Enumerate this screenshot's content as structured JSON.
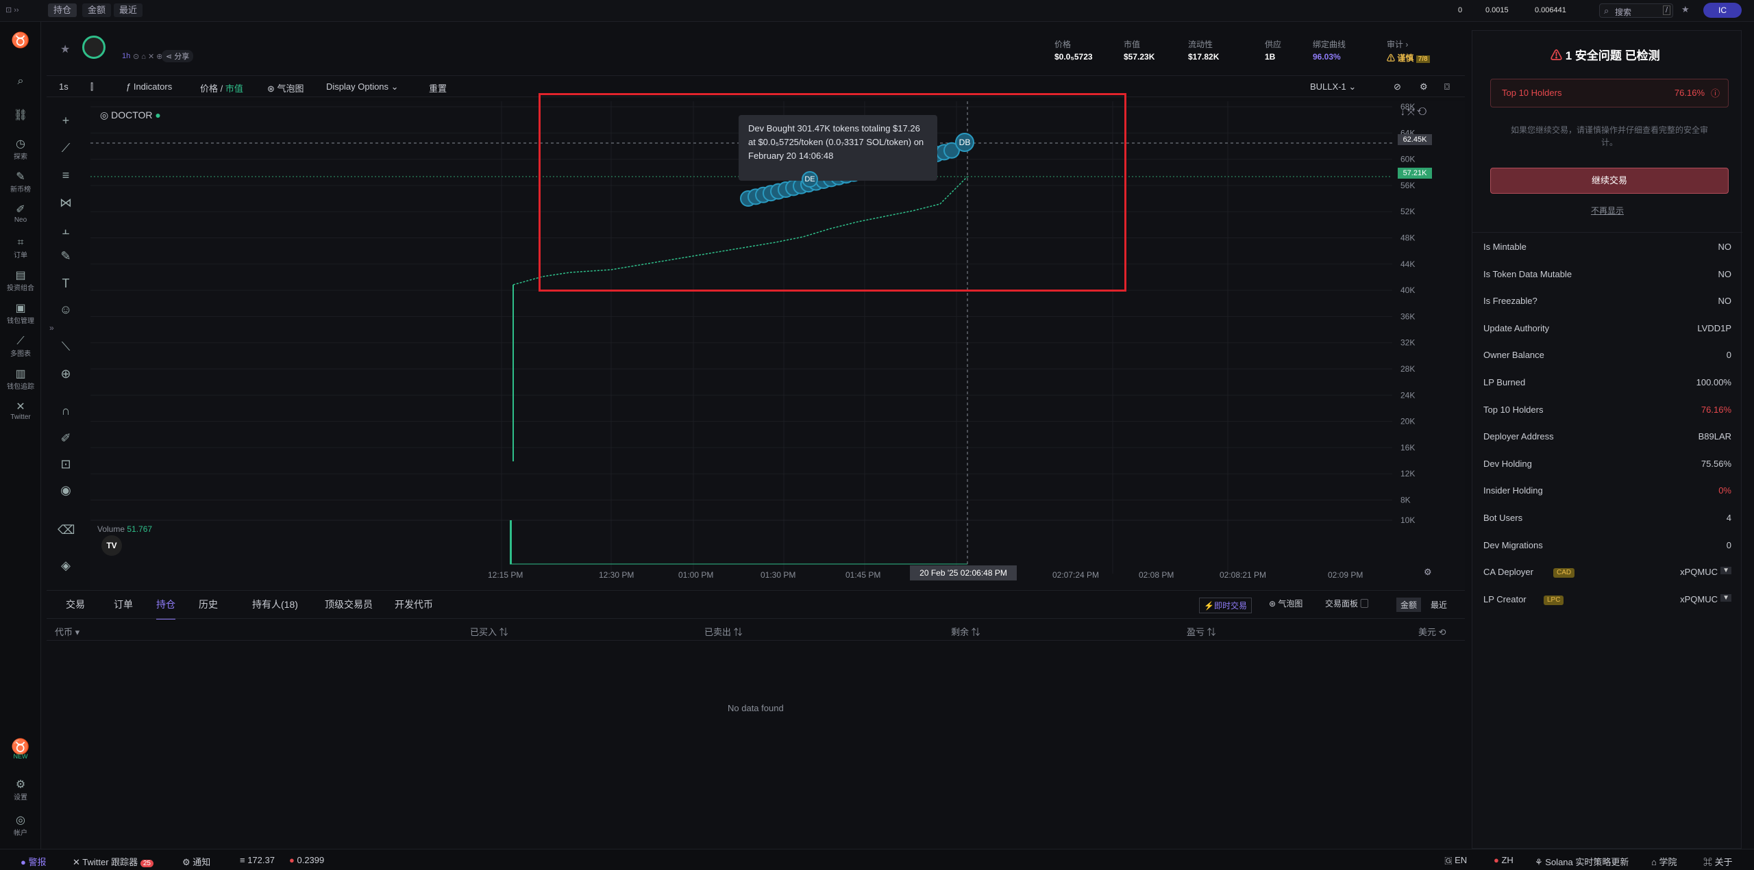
{
  "topbar": {
    "tabs": [
      "持仓",
      "金额",
      "最近"
    ],
    "right": {
      "v1": "0",
      "v2": "0.0015",
      "v3": "0.006441",
      "search_placeholder": "搜索",
      "shortcut": "/",
      "user": "IC"
    }
  },
  "leftnav": {
    "items": [
      "探索",
      "新币榜",
      "Neo",
      "订单",
      "投资组合",
      "钱包管理",
      "多图表",
      "钱包追踪",
      "Twitter"
    ],
    "bottom": [
      "设置",
      "帐户"
    ],
    "new_badge": "NEW"
  },
  "token": {
    "timeframe": "1h",
    "share": "分享",
    "stats": [
      {
        "label": "价格",
        "value": "$0.0₅5723"
      },
      {
        "label": "市值",
        "value": "$57.23K"
      },
      {
        "label": "流动性",
        "value": "$17.82K"
      },
      {
        "label": "供应",
        "value": "1B"
      },
      {
        "label": "绑定曲线",
        "value": "96.03%"
      },
      {
        "label": "审计",
        "value": "谨慎",
        "extra": "7/8"
      }
    ]
  },
  "toolbar": {
    "interval": "1s",
    "indicators": "Indicators",
    "price_label": "价格",
    "mcap_label": "市值",
    "bubble": "气泡图",
    "display": "Display Options",
    "reset": "重置",
    "source": "BULLX-1"
  },
  "chart": {
    "symbol": "DOCTOR",
    "tooltip": "Dev Bought 301.47K tokens totaling $17.26 at $0.0₅5725/token (0.0₇3317 SOL/token) on February 20 14:06:48",
    "volume_label": "Volume",
    "volume_value": "51.767",
    "y_ticks": [
      "68K",
      "64K",
      "60K",
      "56K",
      "52K",
      "48K",
      "44K",
      "40K",
      "36K",
      "32K",
      "28K",
      "24K",
      "20K",
      "16K",
      "12K",
      "8K",
      "10K"
    ],
    "last_price_label": "57.21K",
    "crosshair_label": "62.45K",
    "x_ticks": [
      "12:15 PM",
      "12:30 PM",
      "01:00 PM",
      "01:30 PM",
      "01:45 PM",
      "PM",
      "02:07:24 PM",
      "02:08 PM",
      "02:08:21 PM",
      "02:09 PM"
    ],
    "x_crosshair": "20 Feb '25   02:06:48 PM",
    "db_label": "DB",
    "de_label": "DE"
  },
  "bottom": {
    "tabs": [
      "交易",
      "订单",
      "持仓",
      "历史",
      "持有人(18)",
      "顶级交易员",
      "开发代币"
    ],
    "active_tab": "持仓",
    "right_tabs": [
      "即时交易",
      "气泡图",
      "交易面板",
      "金额",
      "最近"
    ],
    "columns": [
      "代币",
      "已买入",
      "已卖出",
      "剩余",
      "盈亏",
      "美元"
    ],
    "empty": "No data found"
  },
  "right": {
    "title": "1 安全问题 已检测",
    "top10_label": "Top 10 Holders",
    "top10_value": "76.16%",
    "warning": "如果您继续交易，请谨慎操作并仔细查看完整的安全审计。",
    "continue": "继续交易",
    "dont_show": "不再显示",
    "rows": [
      {
        "k": "Is Mintable",
        "v": "NO"
      },
      {
        "k": "Is Token Data Mutable",
        "v": "NO"
      },
      {
        "k": "Is Freezable?",
        "v": "NO"
      },
      {
        "k": "Update Authority",
        "v": "LVDD1P"
      },
      {
        "k": "Owner Balance",
        "v": "0"
      },
      {
        "k": "LP Burned",
        "v": "100.00%"
      },
      {
        "k": "Top 10 Holders",
        "v": "76.16%"
      },
      {
        "k": "Deployer Address",
        "v": "B89LAR"
      },
      {
        "k": "Dev Holding",
        "v": "75.56%"
      },
      {
        "k": "Insider Holding",
        "v": "0%"
      },
      {
        "k": "Bot Users",
        "v": "4"
      },
      {
        "k": "Dev Migrations",
        "v": "0"
      },
      {
        "k": "CA Deployer",
        "v": "xPQMUC",
        "badge": "CAD"
      },
      {
        "k": "LP Creator",
        "v": "xPQMUC",
        "badge": "LPC"
      }
    ],
    "colors": {
      "danger": "#e5484d",
      "accent": "#b14d5a",
      "green": "#2fbf8a"
    }
  },
  "statusbar": {
    "alert": "警报",
    "twitter": "Twitter 跟踪器",
    "twitter_count": "25",
    "notify": "通知",
    "sol": "172.37",
    "gas": "0.2399",
    "lang_en": "EN",
    "lang_zh": "ZH",
    "solana": "Solana 实时策略更新",
    "learn": "学院",
    "about": "关于"
  }
}
